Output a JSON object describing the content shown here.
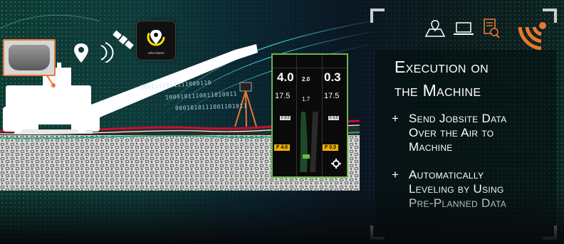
{
  "headline": {
    "line1": "Execution on",
    "line2": "the Machine"
  },
  "bullets": [
    {
      "mark": "+",
      "lines": [
        "Send Jobsite Data",
        "Over the Air to",
        "Machine"
      ]
    },
    {
      "mark": "+",
      "lines": [
        "Automatically",
        "Leveling by Using",
        "Pre-Planned Data"
      ]
    }
  ],
  "app_badge": {
    "label": "John Deere"
  },
  "binary_stream": [
    "0001111011111000110",
    "1000101110011010011",
    "0001010111001101011"
  ],
  "display": {
    "left_top": "4.0",
    "left_mid": "17.5",
    "center_top": "2.0",
    "center_mid": "1.7",
    "right_top": "0.3",
    "right_mid": "17.5",
    "left_tag": "F 0.0",
    "right_tag": "F 0.0",
    "left_target": "F 4.0",
    "right_target": "F 0.3"
  },
  "icons": [
    "map-location-icon",
    "laptop-icon",
    "document-search-icon",
    "wireless-signal-icon",
    "satellite-icon",
    "location-pin-icon",
    "signal-waves-icon",
    "gear-icon"
  ],
  "colors": {
    "accent_orange": "#e8782f",
    "display_border": "#6bb54a",
    "amber": "#f2b000"
  }
}
